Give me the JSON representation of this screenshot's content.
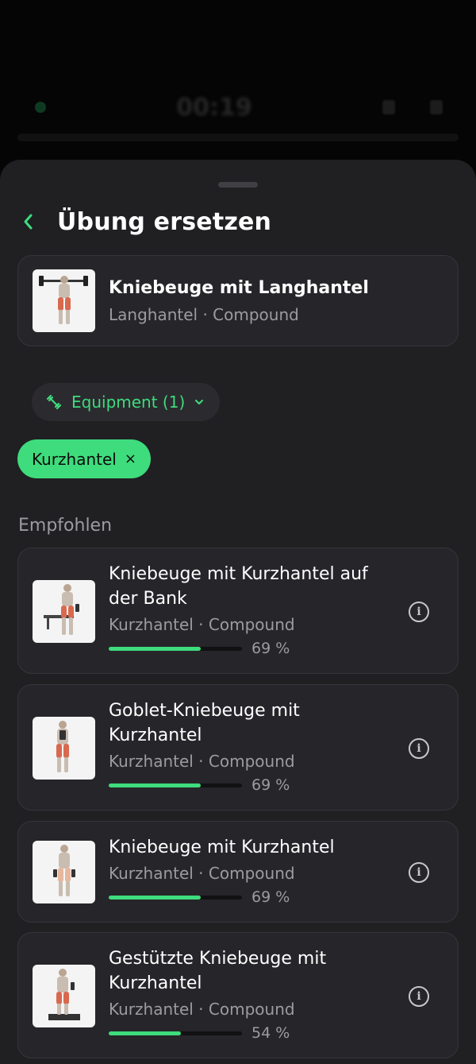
{
  "background": {
    "timer": "00:19"
  },
  "header": {
    "title": "Übung ersetzen"
  },
  "current_exercise": {
    "name": "Kniebeuge mit Langhantel",
    "subtitle": "Langhantel · Compound",
    "thumbnail_icon": "barbell-squat-illustration"
  },
  "filter": {
    "equipment_label": "Equipment (1)",
    "active_chip": "Kurzhantel",
    "chip_remove": "×"
  },
  "section": {
    "label": "Empfohlen"
  },
  "recommendations": [
    {
      "name_line1": "Kniebeuge mit Kurzhantel auf",
      "name_line2": "der Bank",
      "subtitle": "Kurzhantel · Compound",
      "match": 0.69,
      "match_label": "69 %",
      "thumbnail_icon": "bench-dumbbell-squat-illustration"
    },
    {
      "name_line1": "Goblet-Kniebeuge mit",
      "name_line2": "Kurzhantel",
      "subtitle": "Kurzhantel · Compound",
      "match": 0.69,
      "match_label": "69 %",
      "thumbnail_icon": "goblet-squat-illustration"
    },
    {
      "name_line1": "Kniebeuge mit Kurzhantel",
      "name_line2": "",
      "subtitle": "Kurzhantel · Compound",
      "match": 0.69,
      "match_label": "69 %",
      "thumbnail_icon": "dumbbell-squat-illustration"
    },
    {
      "name_line1": "Gestützte Kniebeuge mit",
      "name_line2": "Kurzhantel",
      "subtitle": "Kurzhantel · Compound",
      "match": 0.54,
      "match_label": "54 %",
      "thumbnail_icon": "supported-squat-illustration"
    }
  ],
  "colors": {
    "accent": "#3edc7c",
    "sheet": "#202023",
    "card": "#26262a"
  }
}
